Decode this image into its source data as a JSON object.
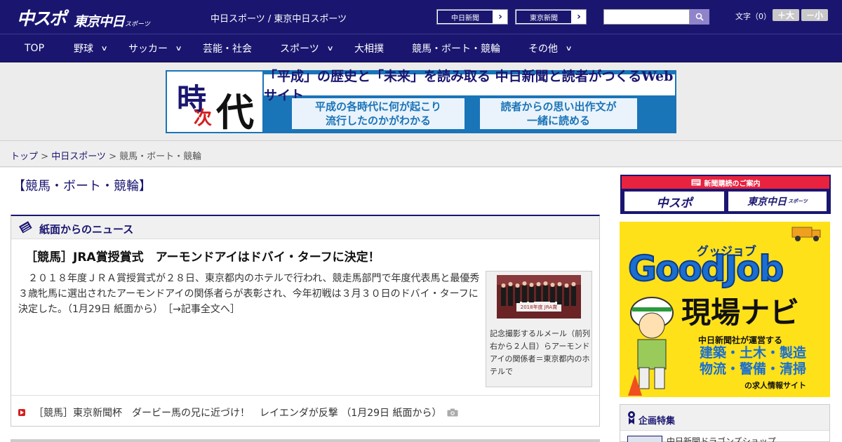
{
  "header": {
    "logo_main": "中スポ",
    "logo_sub": "東京中日",
    "logo_small": "スポーツ",
    "site_title": "中日スポーツ / 東京中日スポーツ",
    "btn1": "中日新聞",
    "btn2": "東京新聞",
    "search_placeholder": "",
    "font_label": "文字（0）",
    "font_bigger": "＋大",
    "font_smaller": "－小"
  },
  "nav": [
    {
      "label": "TOP",
      "chevron": false
    },
    {
      "label": "野球",
      "chevron": true
    },
    {
      "label": "サッカー",
      "chevron": true
    },
    {
      "label": "芸能・社会",
      "chevron": false
    },
    {
      "label": "スポーツ",
      "chevron": true
    },
    {
      "label": "大相撲",
      "chevron": false
    },
    {
      "label": "競馬・ボート・競輪",
      "chevron": false
    },
    {
      "label": "その他",
      "chevron": true
    }
  ],
  "banner": {
    "char1": "時",
    "char2": "次",
    "char3": "代",
    "headline": "「平成」の歴史と「未来」を読み取る 中日新聞と読者がつくるWebサイト",
    "box1_line1": "平成の各時代に何が起こり",
    "box1_line2": "流行したのかがわかる",
    "box2_line1": "読者からの思い出作文が",
    "box2_line2": "一緒に読める"
  },
  "breadcrumb": {
    "top": "トップ",
    "sep": " > ",
    "chunichi": "中日スポーツ",
    "current": "競馬・ボート・競輪"
  },
  "page_heading": "【競馬・ボート・競輪】",
  "news": {
    "section_title": "紙面からのニュース",
    "article_title": "［競馬］JRA賞授賞式　アーモンドアイはドバイ・ターフに決定！",
    "article_body": "２０１８年度ＪＲＡ賞授賞式が２８日、東京都内のホテルで行われ、競走馬部門で年度代表馬と最優秀３歳牝馬に選出されたアーモンドアイの関係者らが表彰され、今年初戦は３月３０日のドバイ・ターフに決定した。（1月29日 紙面から）",
    "read_more": "［→記事全文へ］",
    "photo_text": "2018年度 JRA賞",
    "caption": "記念撮影するルメール（前列右から２人目）らアーモンドアイの関係者＝東京都内のホテルで",
    "sub_item": "［競馬］東京新聞杯　ダービー馬の兄に近づけ！　レイエンダが反撃 （1月29日 紙面から）"
  },
  "sidebar": {
    "sub_guide_title": "新聞購読のご案内",
    "sub_guide_left": "中スポ",
    "sub_guide_right": "東京中日",
    "sub_guide_right_small": "スポーツ",
    "goodjob_small": "グッジョブ",
    "goodjob_big": "GoodJob",
    "goodjob_navi": "現場ナビ",
    "goodjob_sub": "中日新聞社が運営する",
    "goodjob_ind1": "建築・土木・製造",
    "goodjob_ind2": "物流・警備・清掃",
    "goodjob_end": "の求人情報サイト",
    "kikaku_title": "企画特集",
    "kikaku_item": "中日新聞ドラゴンズショップ"
  }
}
